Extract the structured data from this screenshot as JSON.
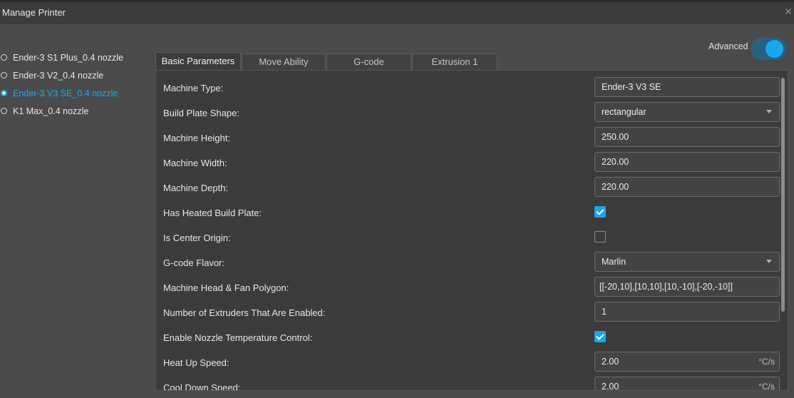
{
  "window": {
    "title": "Manage Printer",
    "close_symbol": "✕"
  },
  "printers": [
    {
      "label": "Ender-3 S1 Plus_0.4 nozzle",
      "selected": false
    },
    {
      "label": "Ender-3 V2_0.4 nozzle",
      "selected": false
    },
    {
      "label": "Ender-3 V3 SE_0.4 nozzle",
      "selected": true
    },
    {
      "label": "K1 Max_0.4 nozzle",
      "selected": false
    }
  ],
  "advanced": {
    "label": "Advanced",
    "enabled": true
  },
  "tabs": [
    {
      "label": "Basic Parameters",
      "active": true
    },
    {
      "label": "Move Ability",
      "active": false
    },
    {
      "label": "G-code",
      "active": false
    },
    {
      "label": "Extrusion 1",
      "active": false
    }
  ],
  "params": {
    "machine_type": {
      "label": "Machine Type:",
      "value": "Ender-3 V3 SE"
    },
    "build_plate_shape": {
      "label": "Build Plate Shape:",
      "value": "rectangular"
    },
    "machine_height": {
      "label": "Machine Height:",
      "value": "250.00"
    },
    "machine_width": {
      "label": "Machine Width:",
      "value": "220.00"
    },
    "machine_depth": {
      "label": "Machine Depth:",
      "value": "220.00"
    },
    "heated_plate": {
      "label": "Has Heated Build Plate:",
      "checked": true
    },
    "center_origin": {
      "label": "Is Center Origin:",
      "checked": false
    },
    "gcode_flavor": {
      "label": "G-code Flavor:",
      "value": "Marlin"
    },
    "head_polygon": {
      "label": "Machine Head & Fan Polygon:",
      "value": "[[-20,10],[10,10],[10,-10],[-20,-10]]"
    },
    "extruders": {
      "label": "Number of Extruders That Are Enabled:",
      "value": "1"
    },
    "nozzle_temp_control": {
      "label": "Enable Nozzle Temperature Control:",
      "checked": true
    },
    "heat_up_speed": {
      "label": "Heat Up Speed:",
      "value": "2.00",
      "unit": "°C/s"
    },
    "cool_down_speed": {
      "label": "Cool Down Speed:",
      "value": "2.00",
      "unit": "°C/s"
    }
  },
  "colors": {
    "accent": "#1aa6ee",
    "background": "#4a4a4b",
    "panel": "#3b3b3c"
  }
}
